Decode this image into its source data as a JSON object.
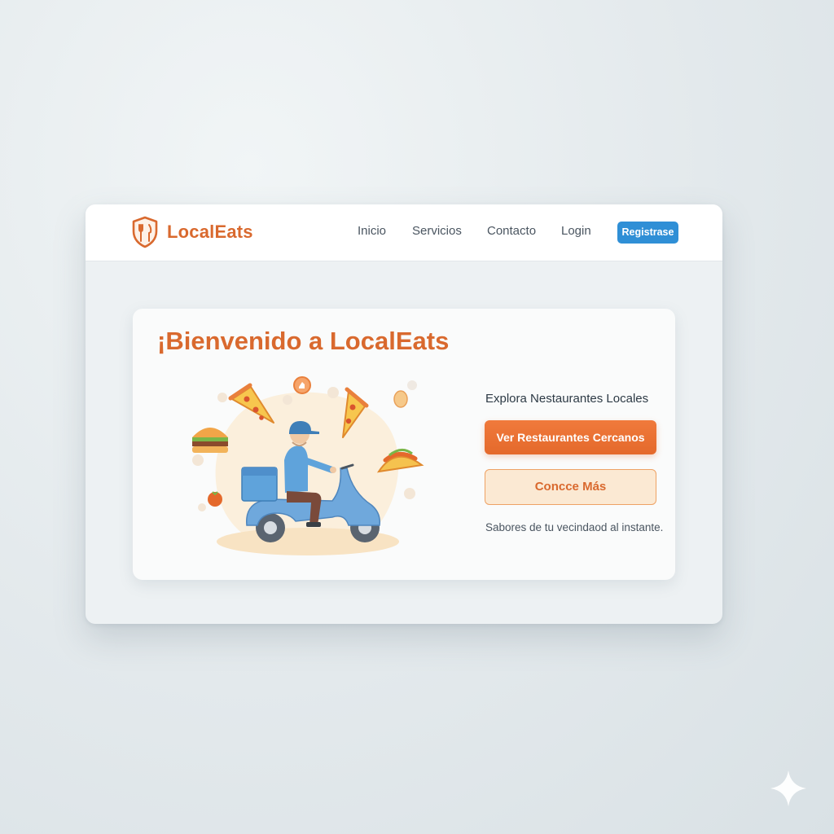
{
  "navbar": {
    "brand": "LocalEats",
    "links": [
      "Inicio",
      "Servicios",
      "Contacto",
      "Login"
    ],
    "register_label": "Registrase"
  },
  "hero": {
    "title": "¡Bienvenido a LocalEats",
    "subtitle": "Explora Nestaurantes Locales",
    "primary_button": "Ver Restaurantes Cercanos",
    "secondary_button": "Concce Más",
    "tagline": "Sabores de tu vecindaod al instante."
  },
  "colors": {
    "brand_orange": "#d9692e",
    "primary_button": "#e4692b",
    "register_blue": "#2f8fd6",
    "secondary_bg": "#fbe9d3"
  },
  "icons": [
    "shield-fork-knife-logo-icon",
    "sparkle-icon"
  ]
}
